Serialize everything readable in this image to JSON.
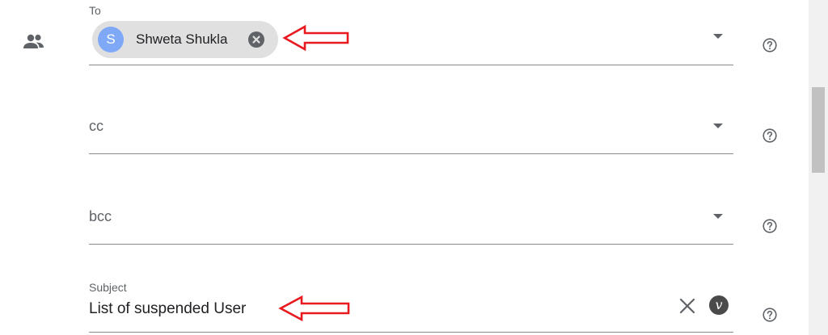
{
  "to_field": {
    "label": "To",
    "recipient": {
      "initial": "S",
      "name": "Shweta Shukla"
    }
  },
  "cc_field": {
    "placeholder": "cc"
  },
  "bcc_field": {
    "placeholder": "bcc"
  },
  "subject_field": {
    "label": "Subject",
    "value": "List of suspended User"
  },
  "icons": {
    "recipients": "people-icon",
    "dropdown": "arrow-drop-down-icon",
    "help": "help-circle-icon",
    "clear": "close-icon",
    "variable": "variable-icon",
    "annotation": "red-arrow-icon"
  },
  "colors": {
    "chip_background": "#e0e0e0",
    "avatar": "#7fa9f7",
    "annotation_arrow": "#e8191f",
    "text": "#202124",
    "secondary_text": "#5f6368"
  }
}
